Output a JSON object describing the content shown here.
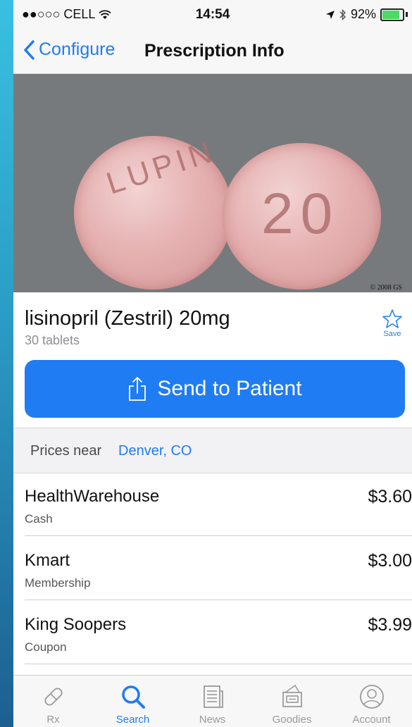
{
  "status_bar": {
    "signal": "●●○○○",
    "carrier": "CELL",
    "wifi": "wifi-icon",
    "time": "14:54",
    "location": "location-arrow-icon",
    "bluetooth": "bluetooth-icon",
    "battery": "92%",
    "battery_level": 0.92
  },
  "nav": {
    "back_label": "Configure",
    "title": "Prescription Info"
  },
  "image": {
    "copyright": "© 2008 GS",
    "imprint_left": "LUPIN",
    "imprint_right": "20"
  },
  "drug": {
    "name": "lisinopril (Zestril) 20mg",
    "quantity": "30 tablets",
    "save_label": "Save"
  },
  "send_button": {
    "label": "Send to Patient"
  },
  "prices": {
    "header_label": "Prices near",
    "location": "Denver, CO",
    "items": [
      {
        "name": "HealthWarehouse",
        "type": "Cash",
        "price": "$3.60"
      },
      {
        "name": "Kmart",
        "type": "Membership",
        "price": "$3.00"
      },
      {
        "name": "King Soopers",
        "type": "Coupon",
        "price": "$3.99"
      }
    ]
  },
  "tabbar": {
    "tabs": [
      {
        "label": "Rx",
        "icon": "pill-icon"
      },
      {
        "label": "Search",
        "icon": "search-icon",
        "active": true
      },
      {
        "label": "News",
        "icon": "news-icon"
      },
      {
        "label": "Goodies",
        "icon": "goodies-icon"
      },
      {
        "label": "Account",
        "icon": "account-icon"
      }
    ]
  },
  "colors": {
    "accent": "#1f7cf3",
    "image_bg": "#777a7c",
    "pill": "#e6b1b1"
  }
}
